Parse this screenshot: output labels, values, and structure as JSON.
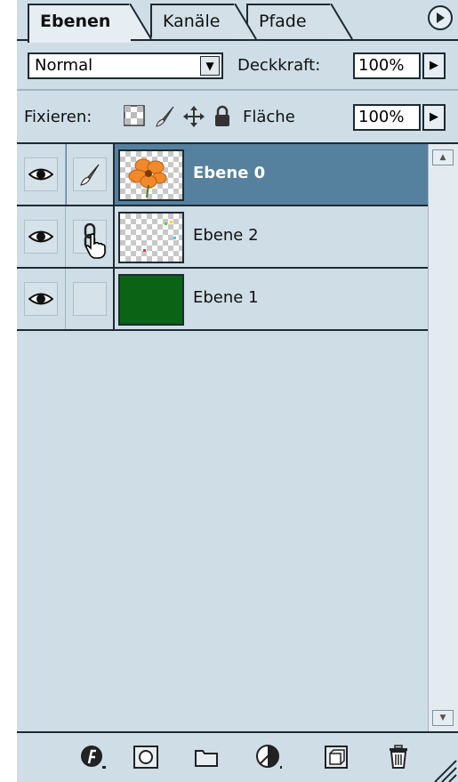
{
  "tabs": [
    {
      "label": "Ebenen",
      "active": true
    },
    {
      "label": "Kanäle",
      "active": false
    },
    {
      "label": "Pfade",
      "active": false
    }
  ],
  "blend_mode": "Normal",
  "opacity_label": "Deckkraft:",
  "opacity_value": "100%",
  "lock_label": "Fixieren:",
  "fill_label": "Fläche",
  "fill_value": "100%",
  "layers": [
    {
      "name": "Ebene 0",
      "selected": true,
      "visible": true,
      "icon": "brush-icon",
      "thumbnail": "orange-flower"
    },
    {
      "name": "Ebene 2",
      "selected": false,
      "visible": true,
      "icon": "chain-link-icon",
      "thumbnail": "transparent"
    },
    {
      "name": "Ebene 1",
      "selected": false,
      "visible": true,
      "icon": "none",
      "thumbnail": "dark-green-fill"
    }
  ],
  "colors": {
    "panel_bg": "#cfdde6",
    "selection": "#55819e",
    "layer1_fill": "#0b6416",
    "flower": "#f08a2a"
  },
  "toolbar_icons": [
    "layer-style-icon",
    "layer-mask-icon",
    "new-group-icon",
    "adjustment-layer-icon",
    "new-layer-icon",
    "trash-icon"
  ]
}
